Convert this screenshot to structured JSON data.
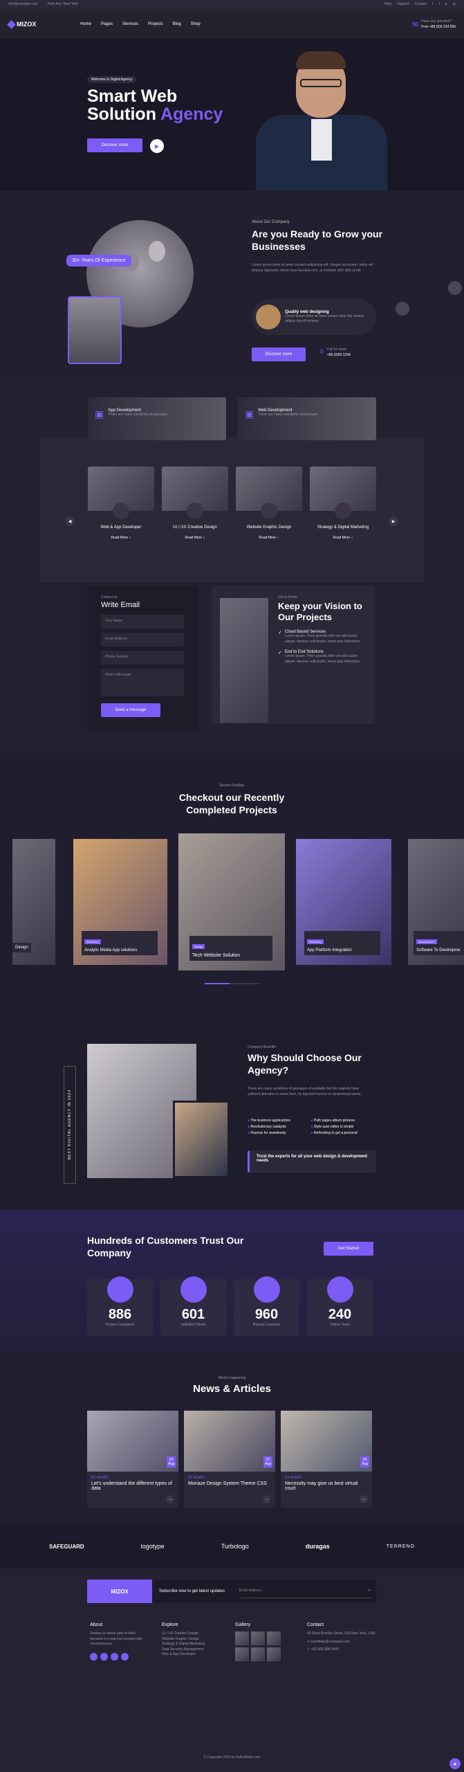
{
  "topbar": {
    "email": "info@example.com",
    "address": "Park Ave, New York",
    "links": [
      "Help",
      "Support",
      "Contact"
    ]
  },
  "nav": {
    "logo": "MIZOX",
    "items": [
      "Home",
      "Pages",
      "Services",
      "Projects",
      "Blog",
      "Shop"
    ],
    "question": "Have any question?",
    "phone": "Free +88 (0)5 234 556"
  },
  "hero": {
    "tag": "Welcome to Digital Agency",
    "title1": "Smart Web",
    "title2": "Solution",
    "title_accent": "Agency",
    "button": "Discover more"
  },
  "about": {
    "badge": "30+ Years Of Experience",
    "subtitle": "About Our Company",
    "title": "Are you Ready to Grow your Businesses",
    "text": "Lorem ipsum dolor sit amet consect adipiscing elit. Integer accumsan, tellus vel tempus dignissim, lorem risus faucibus orci, at molestie nibh nibh ut elit.",
    "feature_title": "Quality web designing",
    "feature_text": "Lorem ipsum dolor sit amet consec tetur the market adipisc ing elit tempor.",
    "button": "Discover more",
    "call_label": "Call for more",
    "call_phone": "+88 (0)55 1234"
  },
  "services_top": [
    {
      "title": "App Development",
      "text": "There are many variations of passages"
    },
    {
      "title": "Web Development",
      "text": "There are many variations of passages"
    }
  ],
  "services": [
    {
      "title": "Web & App Developer",
      "link": "Read More"
    },
    {
      "title": "UI / UX Creative Design",
      "link": "Read More"
    },
    {
      "title": "Website Graphic Design",
      "link": "Read More"
    },
    {
      "title": "Strategy & Digital Marketing",
      "link": "Read More"
    }
  ],
  "contact": {
    "subtitle": "Contact us",
    "title": "Write Email",
    "fields": [
      "Your Name",
      "Email Address",
      "Phone Number",
      "Write a Message"
    ],
    "button": "Send a message"
  },
  "vision": {
    "subtitle": "Get to Know",
    "title": "Keep your Vision to Our Projects",
    "items": [
      {
        "title": "Cloud Based Services",
        "text": "Lorem ipsum. Proin gravida nibh vel velit auctor aliquet. Aenean sollicitudin, lorem quis bibendum."
      },
      {
        "title": "End to End Solutions",
        "text": "Lorem ipsum. Proin gravida nibh vel velit auctor aliquet. Aenean sollicitudin, lorem quis bibendum."
      }
    ]
  },
  "portfolio": {
    "subtitle": "Recent Portfolio",
    "title": "Checkout our Recently Completed Projects",
    "items": [
      {
        "tag": "",
        "title": "Design"
      },
      {
        "tag": "Marketing",
        "title": "Analytic Media App solutions"
      },
      {
        "tag": "Design",
        "title": "Tech Website Solution"
      },
      {
        "tag": "Marketing",
        "title": "App Platform Integration"
      },
      {
        "tag": "Development",
        "title": "Software To Developme"
      }
    ]
  },
  "why": {
    "vertical": "BEST DIGITAL AGENCY IN 2023",
    "subtitle": "Company Benefits",
    "title": "Why Should Choose Our Agency?",
    "text": "There are many variations of passages of available but the majority have suffered alteration in some form, by injected humour or randomised words.",
    "list": [
      "The business applications",
      "Revolutionary catalysts",
      "Humour for seamlessly",
      "Path pages album pictures",
      "Style auto-editor in simple",
      "Refreshing to get a personal"
    ],
    "note": "Trust the experts for all your web design & development needs"
  },
  "stats": {
    "title": "Hundreds of Customers Trust Our Company",
    "button": "Get Started",
    "items": [
      {
        "num": "886",
        "label": "Project Completed"
      },
      {
        "num": "601",
        "label": "Satisfied Clients"
      },
      {
        "num": "960",
        "label": "Repeat Customer"
      },
      {
        "num": "240",
        "label": "Online Team"
      }
    ]
  },
  "news": {
    "subtitle": "What's happening",
    "title": "News & Articles",
    "items": [
      {
        "day": "20",
        "month": "Aug",
        "meta": "BY ADMIN",
        "title": "Let's understand the different types of data"
      },
      {
        "day": "22",
        "month": "Aug",
        "meta": "BY ADMIN",
        "title": "Monaze Design System Theme CSS"
      },
      {
        "day": "24",
        "month": "Aug",
        "meta": "BY ADMIN",
        "title": "Necessity may give us best virtual court"
      }
    ]
  },
  "brands": [
    "SAFEGUARD",
    "logotype",
    "Turbologo",
    "duragas",
    "TERRENO"
  ],
  "footer": {
    "logo": "MIZOX",
    "subscribe": "Subscribe now to get latest updates",
    "email_placeholder": "Email Address",
    "about_title": "About",
    "about_text": "Desires to obtain pain of itself, because it is pain but occasionally circumstances.",
    "explore_title": "Explore",
    "explore": [
      "UI / UX Creative Design",
      "Website Graphic Design",
      "Strategy & Digital Marketing",
      "Data Security Management",
      "Web & App Developer"
    ],
    "gallery_title": "Gallery",
    "contact_title": "Contact",
    "address": "66 Road Broklyn Street, 600 New York, USA",
    "mail": "needhelp@company.com",
    "phone": "+92 666 888 0000",
    "copyright": "© Copyright 2023 by bolbolbinfo.com"
  }
}
